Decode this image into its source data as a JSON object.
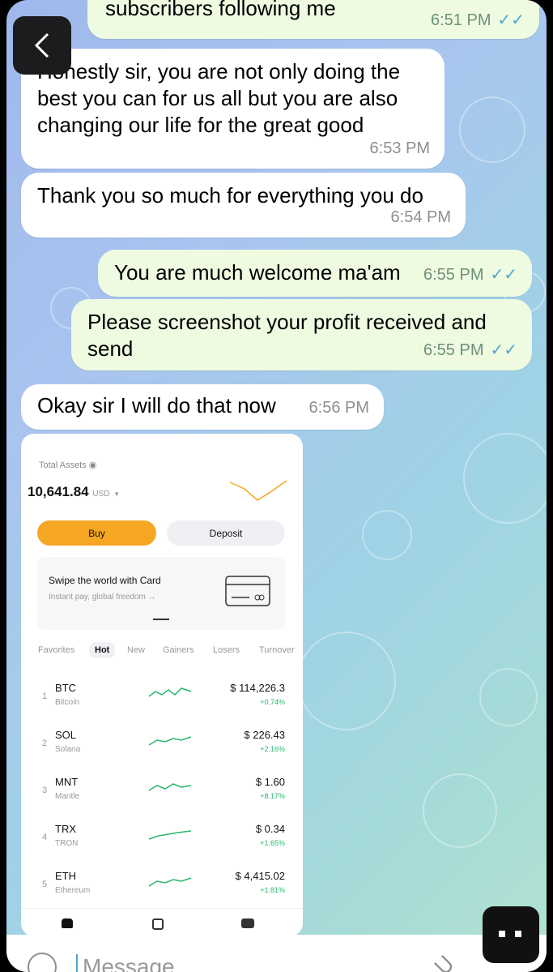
{
  "messages": [
    {
      "text": "subscribers following me",
      "time": "6:51 PM",
      "dir": "out",
      "read": true
    },
    {
      "text": "Honestly sir, you are not only doing the best you can for us all but you are also changing our life for the great good",
      "time": "6:53 PM",
      "dir": "in"
    },
    {
      "text": "Thank you so much for everything you do",
      "time": "6:54 PM",
      "dir": "in"
    },
    {
      "text": "You are much welcome ma'am",
      "time": "6:55 PM",
      "dir": "out",
      "read": true
    },
    {
      "text": "Please screenshot your profit received and send",
      "time": "6:55 PM",
      "dir": "out",
      "read": true
    },
    {
      "text": "Okay sir I will do that now",
      "time": "6:56 PM",
      "dir": "in"
    }
  ],
  "shot": {
    "assets_label": "Total Assets",
    "assets_value": "10,641.84",
    "currency": "USD",
    "buy": "Buy",
    "deposit": "Deposit",
    "card_title": "Swipe the world with Card",
    "card_sub": "Instant pay, global freedom",
    "tabs": [
      "Favorites",
      "Hot",
      "New",
      "Gainers",
      "Losers",
      "Turnover"
    ],
    "active_tab": "Hot",
    "coins": [
      {
        "rank": "1",
        "sym": "BTC",
        "name": "Bitcoin",
        "price": "$ 114,226.3",
        "chg": "+0.74%"
      },
      {
        "rank": "2",
        "sym": "SOL",
        "name": "Solana",
        "price": "$ 226.43",
        "chg": "+2.16%"
      },
      {
        "rank": "3",
        "sym": "MNT",
        "name": "Mantle",
        "price": "$ 1.60",
        "chg": "+8.17%"
      },
      {
        "rank": "4",
        "sym": "TRX",
        "name": "TRON",
        "price": "$ 0.34",
        "chg": "+1.65%"
      },
      {
        "rank": "5",
        "sym": "ETH",
        "name": "Ethereum",
        "price": "$ 4,415.02",
        "chg": "+1.81%"
      }
    ]
  },
  "input": {
    "placeholder": "Message"
  },
  "colors": {
    "accent": "#f5a623",
    "tick": "#50a4d2",
    "positive": "#28b76b"
  }
}
